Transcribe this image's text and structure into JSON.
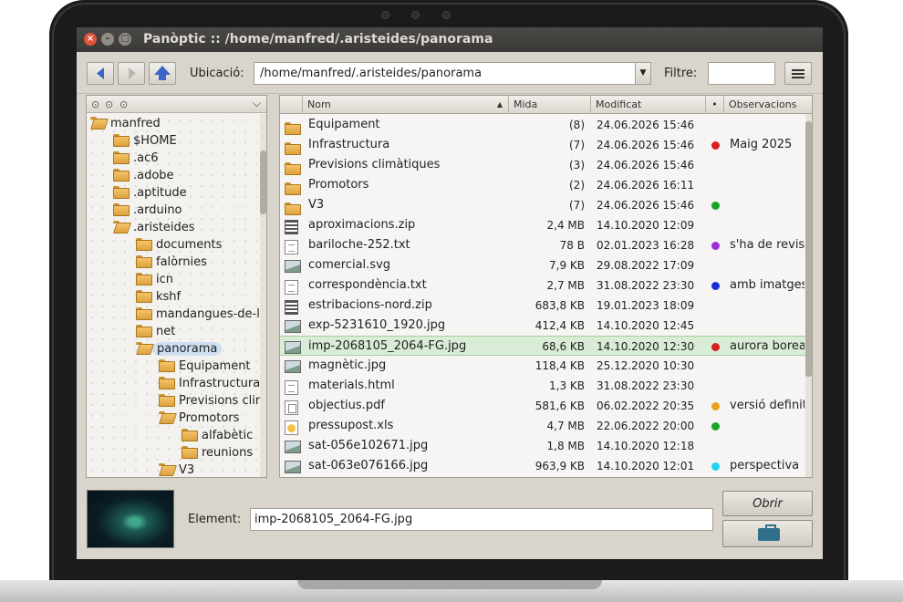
{
  "window": {
    "title": "Panòptic  ::  /home/manfred/.aristeides/panorama",
    "close": "×",
    "min": "–",
    "max": "□"
  },
  "toolbar": {
    "location_label": "Ubicació:",
    "location_value": "/home/manfred/.aristeides/panorama",
    "filter_label": "Filtre:",
    "filter_value": ""
  },
  "tree": {
    "items": [
      {
        "label": "manfred",
        "level": 0,
        "open": true
      },
      {
        "label": "$HOME",
        "level": 1,
        "open": false
      },
      {
        "label": ".ac6",
        "level": 1,
        "open": false
      },
      {
        "label": ".adobe",
        "level": 1,
        "open": false
      },
      {
        "label": ".aptitude",
        "level": 1,
        "open": false
      },
      {
        "label": ".arduino",
        "level": 1,
        "open": false
      },
      {
        "label": ".aristeides",
        "level": 1,
        "open": true
      },
      {
        "label": "documents",
        "level": 2,
        "open": false
      },
      {
        "label": "falòrnies",
        "level": 2,
        "open": false
      },
      {
        "label": "icn",
        "level": 2,
        "open": false
      },
      {
        "label": "kshf",
        "level": 2,
        "open": false
      },
      {
        "label": "mandangues-de-la",
        "level": 2,
        "open": false
      },
      {
        "label": "net",
        "level": 2,
        "open": false
      },
      {
        "label": "panorama",
        "level": 2,
        "open": true,
        "selected": true
      },
      {
        "label": "Equipament",
        "level": 3,
        "open": false
      },
      {
        "label": "Infrastructura",
        "level": 3,
        "open": false
      },
      {
        "label": "Previsions clir",
        "level": 3,
        "open": false
      },
      {
        "label": "Promotors",
        "level": 3,
        "open": true
      },
      {
        "label": "alfabètic",
        "level": 4,
        "open": false
      },
      {
        "label": "reunions",
        "level": 4,
        "open": false
      },
      {
        "label": "V3",
        "level": 3,
        "open": true
      }
    ]
  },
  "columns": {
    "name": "Nom",
    "size": "Mida",
    "modified": "Modificat",
    "mark": "•",
    "notes": "Observacions"
  },
  "files": [
    {
      "icon": "folder-icon",
      "name": "Equipament",
      "size": "(8)",
      "date": "24.06.2026 15:46",
      "dot": "",
      "note": ""
    },
    {
      "icon": "folder-icon",
      "name": "Infrastructura",
      "size": "(7)",
      "date": "24.06.2026 15:46",
      "dot": "#d81f1f",
      "note": "Maig 2025"
    },
    {
      "icon": "folder-icon",
      "name": "Previsions climàtiques",
      "size": "(3)",
      "date": "24.06.2026 15:46",
      "dot": "",
      "note": ""
    },
    {
      "icon": "folder-icon",
      "name": "Promotors",
      "size": "(2)",
      "date": "24.06.2026 16:11",
      "dot": "",
      "note": ""
    },
    {
      "icon": "folder-icon",
      "name": "V3",
      "size": "(7)",
      "date": "24.06.2026 15:46",
      "dot": "#1aa32a",
      "note": ""
    },
    {
      "icon": "zip-icon",
      "name": "aproximacions.zip",
      "size": "2,4 MB",
      "date": "14.10.2020 12:09",
      "dot": "",
      "note": ""
    },
    {
      "icon": "text-file-icon",
      "name": "bariloche-252.txt",
      "size": "78 B",
      "date": "02.01.2023 16:28",
      "dot": "#9b30d9",
      "note": "s'ha de revis"
    },
    {
      "icon": "image-file-icon",
      "name": "comercial.svg",
      "size": "7,9 KB",
      "date": "29.08.2022 17:09",
      "dot": "",
      "note": ""
    },
    {
      "icon": "text-file-icon",
      "name": "correspondència.txt",
      "size": "2,7 MB",
      "date": "31.08.2022 23:30",
      "dot": "#1730d6",
      "note": "amb imatges"
    },
    {
      "icon": "zip-icon",
      "name": "estribacions-nord.zip",
      "size": "683,8 KB",
      "date": "19.01.2023 18:09",
      "dot": "",
      "note": ""
    },
    {
      "icon": "image-file-icon",
      "name": "exp-5231610_1920.jpg",
      "size": "412,4 KB",
      "date": "14.10.2020 12:45",
      "dot": "",
      "note": ""
    },
    {
      "icon": "image-file-icon",
      "name": "imp-2068105_2064-FG.jpg",
      "size": "68,6 KB",
      "date": "14.10.2020 12:30",
      "dot": "#d81f1f",
      "note": "aurora borea",
      "selected": true
    },
    {
      "icon": "image-file-icon",
      "name": "magnètic.jpg",
      "size": "118,4 KB",
      "date": "25.12.2020 10:30",
      "dot": "",
      "note": ""
    },
    {
      "icon": "text-file-icon",
      "name": "materials.html",
      "size": "1,3 KB",
      "date": "31.08.2022 23:30",
      "dot": "",
      "note": ""
    },
    {
      "icon": "pdf-file-icon",
      "name": "objectius.pdf",
      "size": "581,6 KB",
      "date": "06.02.2022 20:35",
      "dot": "#eba01b",
      "note": "versió definit"
    },
    {
      "icon": "spreadsheet-icon",
      "name": "pressupost.xls",
      "size": "4,7 MB",
      "date": "22.06.2022 20:00",
      "dot": "#1aa32a",
      "note": ""
    },
    {
      "icon": "image-file-icon",
      "name": "sat-056e102671.jpg",
      "size": "1,8 MB",
      "date": "14.10.2020 12:18",
      "dot": "",
      "note": ""
    },
    {
      "icon": "image-file-icon",
      "name": "sat-063e076166.jpg",
      "size": "963,9 KB",
      "date": "14.10.2020 12:01",
      "dot": "#22d3ee",
      "note": "perspectiva"
    }
  ],
  "bottom": {
    "element_label": "Element:",
    "element_value": "imp-2068105_2064-FG.jpg",
    "open_label": "Obrir"
  }
}
